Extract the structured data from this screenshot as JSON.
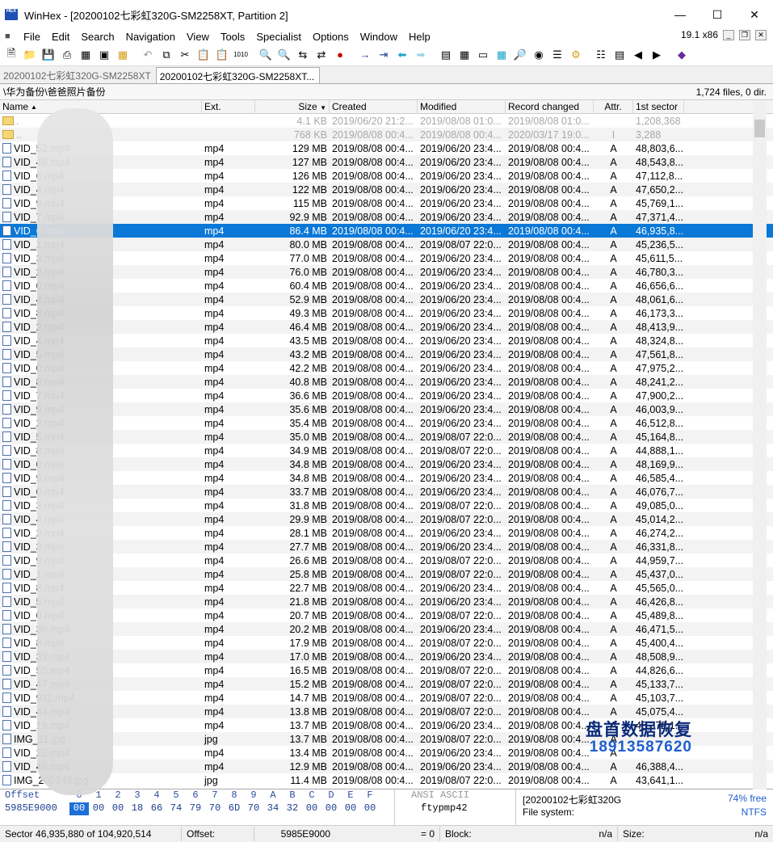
{
  "window": {
    "title": "WinHex - [20200102七彩虹320G-SM2258XT, Partition 2]",
    "icon_text": "HEX"
  },
  "menu": {
    "items": [
      "File",
      "Edit",
      "Search",
      "Navigation",
      "View",
      "Tools",
      "Specialist",
      "Options",
      "Window",
      "Help"
    ],
    "version": "19.1 x86"
  },
  "tabs": [
    "20200102七彩虹320G-SM2258XT",
    "20200102七彩虹320G-SM2258XT..."
  ],
  "path": {
    "current": "\\华为备份\\爸爸照片备份",
    "summary": "1,724 files, 0 dir."
  },
  "columns": {
    "name": "Name",
    "ext": "Ext.",
    "size": "Size",
    "created": "Created",
    "modified": "Modified",
    "record": "Record changed",
    "attr": "Attr.",
    "sector": "1st sector"
  },
  "files": [
    {
      "name": ".",
      "ext": "",
      "size": "4.1 KB",
      "created": "2019/06/20 21:2...",
      "modified": "2019/08/08 01:0...",
      "record": "2019/08/08 01:0...",
      "attr": "",
      "sector": "1,208,368",
      "kind": "folder",
      "dim": true
    },
    {
      "name": "..",
      "ext": "",
      "size": "768 KB",
      "created": "2019/08/08 00:4...",
      "modified": "2019/08/08 00:4...",
      "record": "2020/03/17 19:0...",
      "attr": "I",
      "sector": "3,288",
      "kind": "folder",
      "dim": true
    },
    {
      "name": "VID_52.mp4",
      "ext": "mp4",
      "size": "129 MB",
      "created": "2019/08/08 00:4...",
      "modified": "2019/06/20 23:4...",
      "record": "2019/08/08 00:4...",
      "attr": "A",
      "sector": "48,803,6..."
    },
    {
      "name": "VID_48.mp4",
      "ext": "mp4",
      "size": "127 MB",
      "created": "2019/08/08 00:4...",
      "modified": "2019/06/20 23:4...",
      "record": "2019/08/08 00:4...",
      "attr": "A",
      "sector": "48,543,8..."
    },
    {
      "name": "VID_6.mp4",
      "ext": "mp4",
      "size": "126 MB",
      "created": "2019/08/08 00:4...",
      "modified": "2019/06/20 23:4...",
      "record": "2019/08/08 00:4...",
      "attr": "A",
      "sector": "47,112,8..."
    },
    {
      "name": "VID_4.mp4",
      "ext": "mp4",
      "size": "122 MB",
      "created": "2019/08/08 00:4...",
      "modified": "2019/06/20 23:4...",
      "record": "2019/08/08 00:4...",
      "attr": "A",
      "sector": "47,650,2..."
    },
    {
      "name": "VID_9.mp4",
      "ext": "mp4",
      "size": "115 MB",
      "created": "2019/08/08 00:4...",
      "modified": "2019/06/20 23:4...",
      "record": "2019/08/08 00:4...",
      "attr": "A",
      "sector": "45,769,1..."
    },
    {
      "name": "VID_7.mp4",
      "ext": "mp4",
      "size": "92.9 MB",
      "created": "2019/08/08 00:4...",
      "modified": "2019/06/20 23:4...",
      "record": "2019/08/08 00:4...",
      "attr": "A",
      "sector": "47,371,4..."
    },
    {
      "name": "VID_6.mp4",
      "ext": "mp4",
      "size": "86.4 MB",
      "created": "2019/08/08 00:4...",
      "modified": "2019/06/20 23:4...",
      "record": "2019/08/08 00:4...",
      "attr": "A",
      "sector": "46,935,8...",
      "selected": true
    },
    {
      "name": "VID_1.mp4",
      "ext": "mp4",
      "size": "80.0 MB",
      "created": "2019/08/08 00:4...",
      "modified": "2019/08/07 22:0...",
      "record": "2019/08/08 00:4...",
      "attr": "A",
      "sector": "45,236,5..."
    },
    {
      "name": "VID_3.mp4",
      "ext": "mp4",
      "size": "77.0 MB",
      "created": "2019/08/08 00:4...",
      "modified": "2019/06/20 23:4...",
      "record": "2019/08/08 00:4...",
      "attr": "A",
      "sector": "45,611,5..."
    },
    {
      "name": "VID_2.mp4",
      "ext": "mp4",
      "size": "76.0 MB",
      "created": "2019/08/08 00:4...",
      "modified": "2019/06/20 23:4...",
      "record": "2019/08/08 00:4...",
      "attr": "A",
      "sector": "46,780,3..."
    },
    {
      "name": "VID_0.mp4",
      "ext": "mp4",
      "size": "60.4 MB",
      "created": "2019/08/08 00:4...",
      "modified": "2019/06/20 23:4...",
      "record": "2019/08/08 00:4...",
      "attr": "A",
      "sector": "46,656,6..."
    },
    {
      "name": "VID_4.mp4",
      "ext": "mp4",
      "size": "52.9 MB",
      "created": "2019/08/08 00:4...",
      "modified": "2019/06/20 23:4...",
      "record": "2019/08/08 00:4...",
      "attr": "A",
      "sector": "48,061,6..."
    },
    {
      "name": "VID_8.mp4",
      "ext": "mp4",
      "size": "49.3 MB",
      "created": "2019/08/08 00:4...",
      "modified": "2019/06/20 23:4...",
      "record": "2019/08/08 00:4...",
      "attr": "A",
      "sector": "46,173,3..."
    },
    {
      "name": "VID_2.mp4",
      "ext": "mp4",
      "size": "46.4 MB",
      "created": "2019/08/08 00:4...",
      "modified": "2019/06/20 23:4...",
      "record": "2019/08/08 00:4...",
      "attr": "A",
      "sector": "48,413,9..."
    },
    {
      "name": "VID_4.mp4",
      "ext": "mp4",
      "size": "43.5 MB",
      "created": "2019/08/08 00:4...",
      "modified": "2019/06/20 23:4...",
      "record": "2019/08/08 00:4...",
      "attr": "A",
      "sector": "48,324,8..."
    },
    {
      "name": "VID_5.mp4",
      "ext": "mp4",
      "size": "43.2 MB",
      "created": "2019/08/08 00:4...",
      "modified": "2019/06/20 23:4...",
      "record": "2019/08/08 00:4...",
      "attr": "A",
      "sector": "47,561,8..."
    },
    {
      "name": "VID_0.mp4",
      "ext": "mp4",
      "size": "42.2 MB",
      "created": "2019/08/08 00:4...",
      "modified": "2019/06/20 23:4...",
      "record": "2019/08/08 00:4...",
      "attr": "A",
      "sector": "47,975,2..."
    },
    {
      "name": "VID_8.mp4",
      "ext": "mp4",
      "size": "40.8 MB",
      "created": "2019/08/08 00:4...",
      "modified": "2019/06/20 23:4...",
      "record": "2019/08/08 00:4...",
      "attr": "A",
      "sector": "48,241,2..."
    },
    {
      "name": "VID_7.mp4",
      "ext": "mp4",
      "size": "36.6 MB",
      "created": "2019/08/08 00:4...",
      "modified": "2019/06/20 23:4...",
      "record": "2019/08/08 00:4...",
      "attr": "A",
      "sector": "47,900,2..."
    },
    {
      "name": "VID_9.mp4",
      "ext": "mp4",
      "size": "35.6 MB",
      "created": "2019/08/08 00:4...",
      "modified": "2019/06/20 23:4...",
      "record": "2019/08/08 00:4...",
      "attr": "A",
      "sector": "46,003,9..."
    },
    {
      "name": "VID_2.mp4",
      "ext": "mp4",
      "size": "35.4 MB",
      "created": "2019/08/08 00:4...",
      "modified": "2019/06/20 23:4...",
      "record": "2019/08/08 00:4...",
      "attr": "A",
      "sector": "46,512,8..."
    },
    {
      "name": "VID_5.mp4",
      "ext": "mp4",
      "size": "35.0 MB",
      "created": "2019/08/08 00:4...",
      "modified": "2019/08/07 22:0...",
      "record": "2019/08/08 00:4...",
      "attr": "A",
      "sector": "45,164,8..."
    },
    {
      "name": "VID_8.mp4",
      "ext": "mp4",
      "size": "34.9 MB",
      "created": "2019/08/08 00:4...",
      "modified": "2019/08/07 22:0...",
      "record": "2019/08/08 00:4...",
      "attr": "A",
      "sector": "44,888,1..."
    },
    {
      "name": "VID_0.mp4",
      "ext": "mp4",
      "size": "34.8 MB",
      "created": "2019/08/08 00:4...",
      "modified": "2019/06/20 23:4...",
      "record": "2019/08/08 00:4...",
      "attr": "A",
      "sector": "48,169,9..."
    },
    {
      "name": "VID_9.mp4",
      "ext": "mp4",
      "size": "34.8 MB",
      "created": "2019/08/08 00:4...",
      "modified": "2019/06/20 23:4...",
      "record": "2019/08/08 00:4...",
      "attr": "A",
      "sector": "46,585,4..."
    },
    {
      "name": "VID_0.mp4",
      "ext": "mp4",
      "size": "33.7 MB",
      "created": "2019/08/08 00:4...",
      "modified": "2019/06/20 23:4...",
      "record": "2019/08/08 00:4...",
      "attr": "A",
      "sector": "46,076,7..."
    },
    {
      "name": "VID_3.mp4",
      "ext": "mp4",
      "size": "31.8 MB",
      "created": "2019/08/08 00:4...",
      "modified": "2019/08/07 22:0...",
      "record": "2019/08/08 00:4...",
      "attr": "A",
      "sector": "49,085,0..."
    },
    {
      "name": "VID_4.mp4",
      "ext": "mp4",
      "size": "29.9 MB",
      "created": "2019/08/08 00:4...",
      "modified": "2019/08/07 22:0...",
      "record": "2019/08/08 00:4...",
      "attr": "A",
      "sector": "45,014,2..."
    },
    {
      "name": "VID_2.mp4",
      "ext": "mp4",
      "size": "28.1 MB",
      "created": "2019/08/08 00:4...",
      "modified": "2019/06/20 23:4...",
      "record": "2019/08/08 00:4...",
      "attr": "A",
      "sector": "46,274,2..."
    },
    {
      "name": "VID_3.mp4",
      "ext": "mp4",
      "size": "27.7 MB",
      "created": "2019/08/08 00:4...",
      "modified": "2019/06/20 23:4...",
      "record": "2019/08/08 00:4...",
      "attr": "A",
      "sector": "46,331,8..."
    },
    {
      "name": "VID_9.mp4",
      "ext": "mp4",
      "size": "26.6 MB",
      "created": "2019/08/08 00:4...",
      "modified": "2019/08/07 22:0...",
      "record": "2019/08/08 00:4...",
      "attr": "A",
      "sector": "44,959,7..."
    },
    {
      "name": "VID_1.mp4",
      "ext": "mp4",
      "size": "25.8 MB",
      "created": "2019/08/08 00:4...",
      "modified": "2019/08/07 22:0...",
      "record": "2019/08/08 00:4...",
      "attr": "A",
      "sector": "45,437,0..."
    },
    {
      "name": "VID_8.mp4",
      "ext": "mp4",
      "size": "22.7 MB",
      "created": "2019/08/08 00:4...",
      "modified": "2019/06/20 23:4...",
      "record": "2019/08/08 00:4...",
      "attr": "A",
      "sector": "45,565,0..."
    },
    {
      "name": "VID_5.mp4",
      "ext": "mp4",
      "size": "21.8 MB",
      "created": "2019/08/08 00:4...",
      "modified": "2019/06/20 23:4...",
      "record": "2019/08/08 00:4...",
      "attr": "A",
      "sector": "46,426,8..."
    },
    {
      "name": "VID_0.mp4",
      "ext": "mp4",
      "size": "20.7 MB",
      "created": "2019/08/08 00:4...",
      "modified": "2019/08/07 22:0...",
      "record": "2019/08/08 00:4...",
      "attr": "A",
      "sector": "45,489,8..."
    },
    {
      "name": "VID_36.mp4",
      "ext": "mp4",
      "size": "20.2 MB",
      "created": "2019/08/08 00:4...",
      "modified": "2019/06/20 23:4...",
      "record": "2019/08/08 00:4...",
      "attr": "A",
      "sector": "46,471,5..."
    },
    {
      "name": "VID_8.mp4",
      "ext": "mp4",
      "size": "17.9 MB",
      "created": "2019/08/08 00:4...",
      "modified": "2019/08/07 22:0...",
      "record": "2019/08/08 00:4...",
      "attr": "A",
      "sector": "45,400,4..."
    },
    {
      "name": "VID_33.mp4",
      "ext": "mp4",
      "size": "17.0 MB",
      "created": "2019/08/08 00:4...",
      "modified": "2019/06/20 23:4...",
      "record": "2019/08/08 00:4...",
      "attr": "A",
      "sector": "48,508,9..."
    },
    {
      "name": "VID_55.mp4",
      "ext": "mp4",
      "size": "16.5 MB",
      "created": "2019/08/08 00:4...",
      "modified": "2019/08/07 22:0...",
      "record": "2019/08/08 00:4...",
      "attr": "A",
      "sector": "44,826,6..."
    },
    {
      "name": "VID_47.mp4",
      "ext": "mp4",
      "size": "15.2 MB",
      "created": "2019/08/08 00:4...",
      "modified": "2019/08/07 22:0...",
      "record": "2019/08/08 00:4...",
      "attr": "A",
      "sector": "45,133,7..."
    },
    {
      "name": "VID_911.mp4",
      "ext": "mp4",
      "size": "14.7 MB",
      "created": "2019/08/08 00:4...",
      "modified": "2019/08/07 22:0...",
      "record": "2019/08/08 00:4...",
      "attr": "A",
      "sector": "45,103,7..."
    },
    {
      "name": "VID_44.mp4",
      "ext": "mp4",
      "size": "13.8 MB",
      "created": "2019/08/08 00:4...",
      "modified": "2019/08/07 22:0...",
      "record": "2019/08/08 00:4...",
      "attr": "A",
      "sector": "45,075,4..."
    },
    {
      "name": "VID_19.mp4",
      "ext": "mp4",
      "size": "13.7 MB",
      "created": "2019/08/08 00:4...",
      "modified": "2019/06/20 23:4...",
      "record": "2019/08/08 00:4...",
      "attr": "A",
      "sector": "48,372,1..."
    },
    {
      "name": "IMG_11.jpg",
      "ext": "jpg",
      "size": "13.7 MB",
      "created": "2019/08/08 00:4...",
      "modified": "2019/08/07 22:0...",
      "record": "2019/08/08 00:4...",
      "attr": "A",
      "sector": ""
    },
    {
      "name": "VID_22.mp4",
      "ext": "mp4",
      "size": "13.4 MB",
      "created": "2019/08/08 00:4...",
      "modified": "2019/06/20 23:4...",
      "record": "2019/08/08 00:4...",
      "attr": "A",
      "sector": ""
    },
    {
      "name": "VID_46.mp4",
      "ext": "mp4",
      "size": "12.9 MB",
      "created": "2019/08/08 00:4...",
      "modified": "2019/06/20 23:4...",
      "record": "2019/08/08 00:4...",
      "attr": "A",
      "sector": "46,388,4..."
    },
    {
      "name": "IMG_205249.jpg",
      "ext": "jpg",
      "size": "11.4 MB",
      "created": "2019/08/08 00:4...",
      "modified": "2019/08/07 22:0...",
      "record": "2019/08/08 00:4...",
      "attr": "A",
      "sector": "43,641,1..."
    }
  ],
  "watermark": {
    "line1": "盘首数据恢复",
    "line2": "18913587620"
  },
  "hex": {
    "offset_label": "Offset",
    "columns": [
      "0",
      "1",
      "2",
      "3",
      "4",
      "5",
      "6",
      "7",
      "8",
      "9",
      "A",
      "B",
      "C",
      "D",
      "E",
      "F"
    ],
    "row_offset": "5985E9000",
    "bytes": [
      "00",
      "00",
      "00",
      "18",
      "66",
      "74",
      "79",
      "70",
      "6D",
      "70",
      "34",
      "32",
      "00",
      "00",
      "00",
      "00"
    ],
    "charset": "ANSI ASCII",
    "text": "ftypmp42",
    "info_title": "[20200102七彩虹320G",
    "free": "74% free",
    "fs_label": "File system:",
    "fs_value": "NTFS"
  },
  "status": {
    "sector": "Sector 46,935,880 of 104,920,514",
    "offset_label": "Offset:",
    "offset_value": "5985E9000",
    "eq": "= 0",
    "block_label": "Block:",
    "block_value": "n/a",
    "size_label": "Size:",
    "size_value": "n/a"
  }
}
